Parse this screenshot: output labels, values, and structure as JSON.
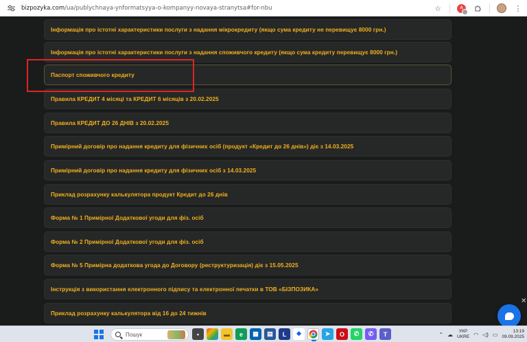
{
  "browser": {
    "url_host": "bizpozyka.com",
    "url_path": "/ua/publychnaya-ynformatsyya-o-kompanyy-novaya-stranytsa#for-nbu"
  },
  "documents": [
    {
      "label": "Інформація про істотні характеристики послуги з надання мікрокредиту (якщо сума кредиту не перевищує 8000 грн.)"
    },
    {
      "label": "Інформація про істотні характеристики послуги з надання споживчого кредиту (якщо сума кредиту перевищує 8000 грн.)"
    },
    {
      "label": "Паспорт споживчого кредиту"
    },
    {
      "label": "Правила КРЕДИТ 4 місяці та КРЕДИТ 6 місяців з 20.02.2025"
    },
    {
      "label": "Правила КРЕДИТ ДО 26 ДНІВ з 20.02.2025"
    },
    {
      "label": "Примірний договір про надання кредиту для фізичних осіб (продукт «Кредит до 26 днів») діє з 14.03.2025"
    },
    {
      "label": "Примірний договір про надання кредиту для фізичних осіб з 14.03.2025"
    },
    {
      "label": "Приклад розрахунку калькулятора продукт Кредит до 26 днів"
    },
    {
      "label": "Форма № 1 Примірної Додаткової угоди для фіз. осіб"
    },
    {
      "label": "Форма № 2 Примірної Додаткової угоди для фіз. осіб"
    },
    {
      "label": "Форма № 5 Примірна додаткова угода до Договору (реструктуризація) діє з 15.05.2025"
    },
    {
      "label": "Інструкція з використання електронного підпису та електронної печатки в ТОВ «БІЗПОЗИКА»"
    },
    {
      "label": "Приклад розрахунку калькулятора від 16 до 24 тижнів"
    }
  ],
  "taskbar": {
    "search_placeholder": "Пошук",
    "language_line1": "УКР",
    "language_line2": "UKRE",
    "time": "13:19",
    "date": "09.09.2025"
  },
  "colors": {
    "page_bg": "#1a1c1b",
    "item_bg": "#262827",
    "item_text": "#f2b01e",
    "highlight": "#e02424",
    "chat_button": "#1a73e8"
  },
  "icons": [
    "site-info-icon",
    "star-icon",
    "extension-icon",
    "puzzle-icon",
    "profile-avatar",
    "menu-dots-icon",
    "chat-icon",
    "windows-start-icon",
    "search-icon"
  ]
}
